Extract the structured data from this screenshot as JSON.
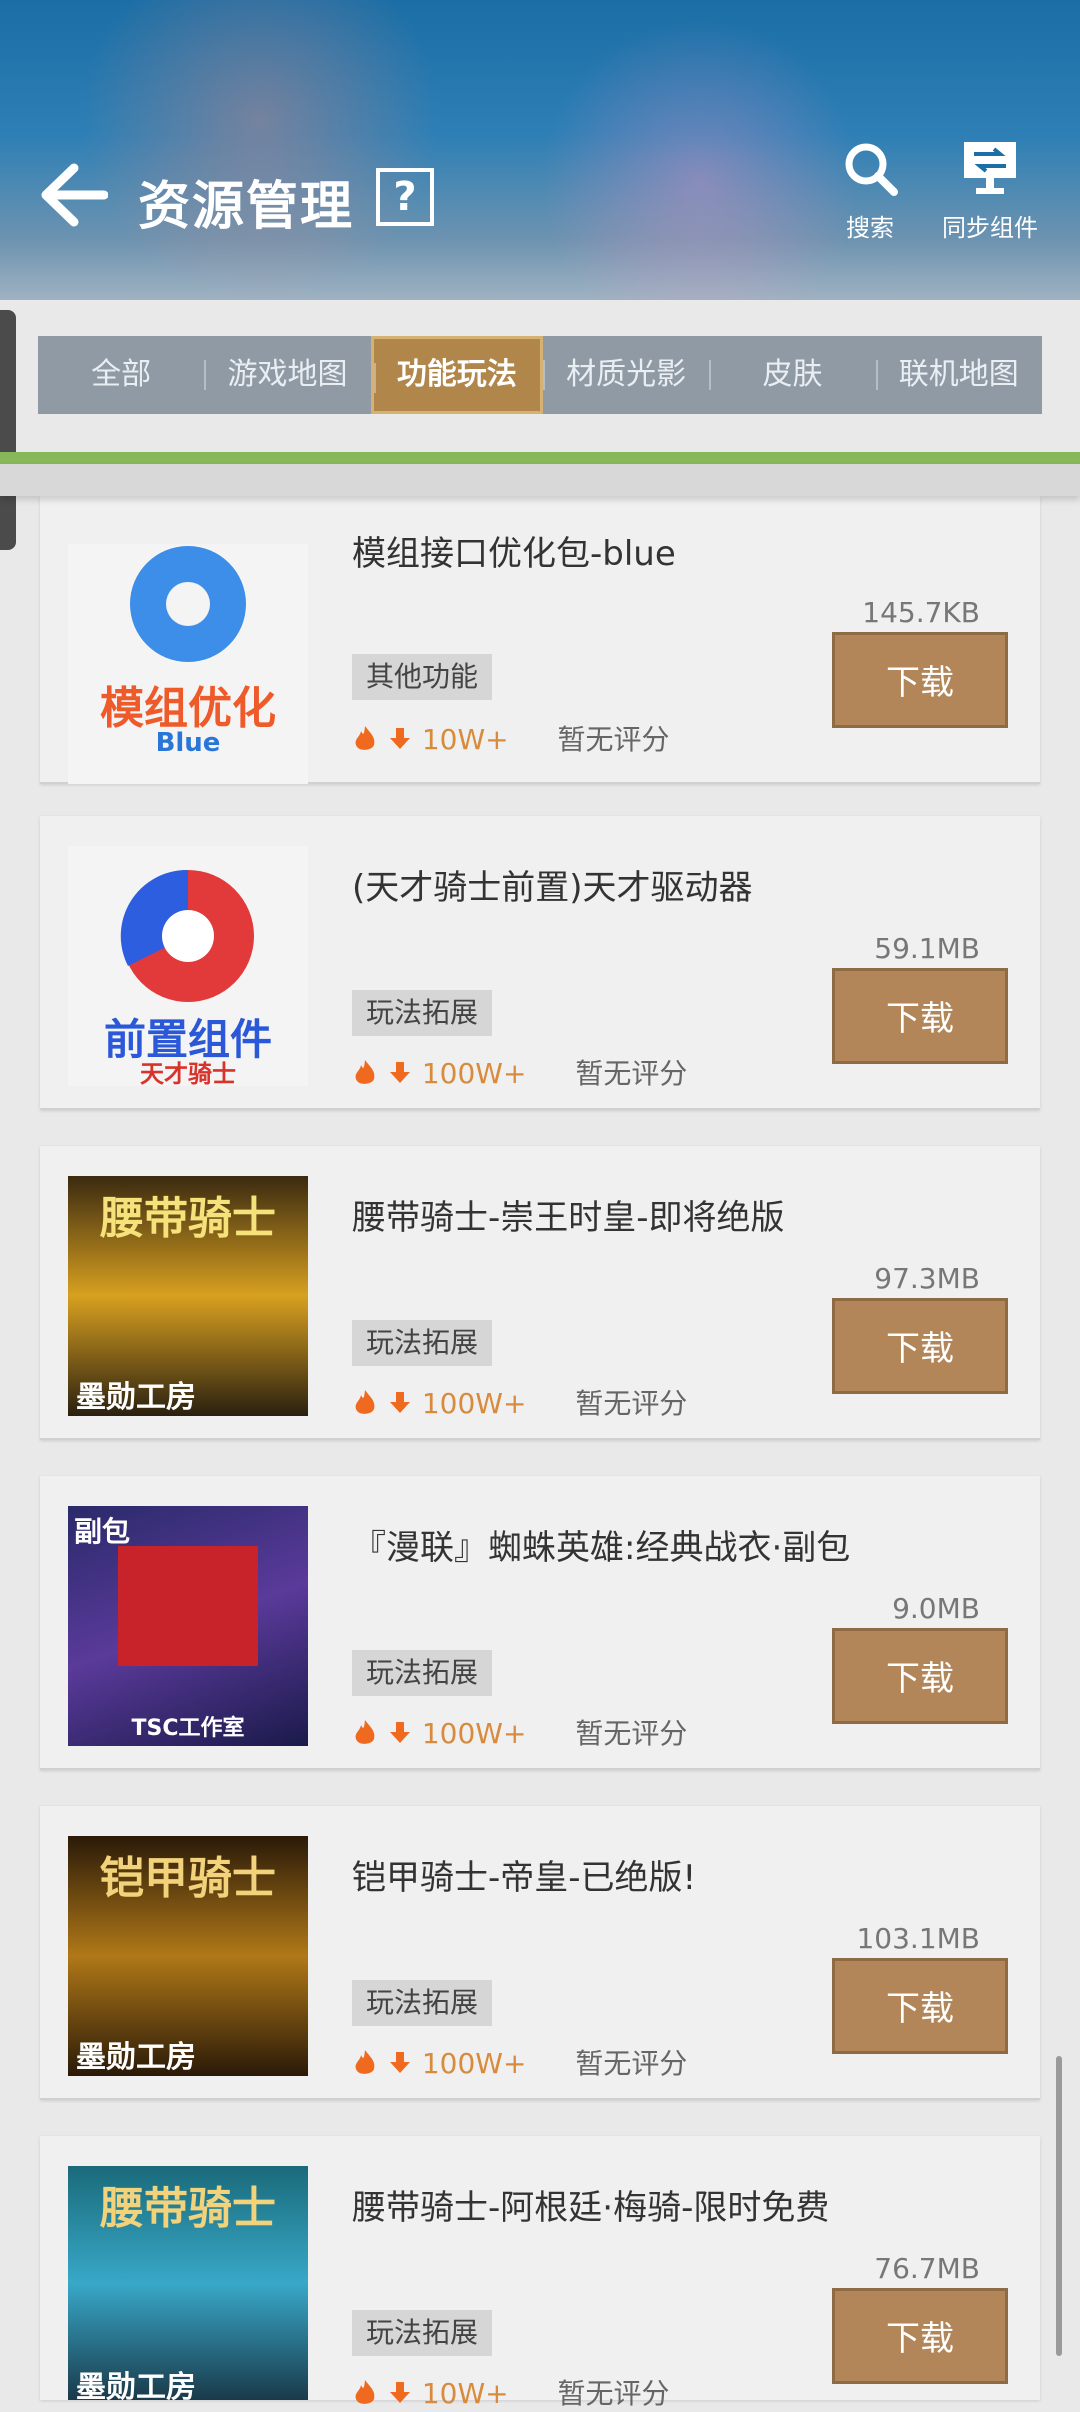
{
  "header": {
    "title": "资源管理",
    "help_symbol": "?",
    "search_label": "搜索",
    "sync_label": "同步组件"
  },
  "tabs": [
    {
      "label": "全部",
      "active": false
    },
    {
      "label": "游戏地图",
      "active": false
    },
    {
      "label": "功能玩法",
      "active": true
    },
    {
      "label": "材质光影",
      "active": false
    },
    {
      "label": "皮肤",
      "active": false
    },
    {
      "label": "联机地图",
      "active": false
    }
  ],
  "items": [
    {
      "title": "模组接口优化包-blue",
      "size": "145.7KB",
      "tag": "其他功能",
      "downloads": "10W+",
      "rating": "暂无评分",
      "download_label": "下载",
      "thumb_text": "模组优化",
      "thumb_sub": "Blue"
    },
    {
      "title": "(天才骑士前置)天才驱动器",
      "size": "59.1MB",
      "tag": "玩法拓展",
      "downloads": "100W+",
      "rating": "暂无评分",
      "download_label": "下载",
      "thumb_text": "前置组件",
      "thumb_sub": "天才骑士"
    },
    {
      "title": "腰带骑士-崇王时皇-即将绝版",
      "size": "97.3MB",
      "tag": "玩法拓展",
      "downloads": "100W+",
      "rating": "暂无评分",
      "download_label": "下载",
      "thumb_text": "腰带骑士",
      "thumb_sub": "墨勋工房"
    },
    {
      "title": "『漫联』蜘蛛英雄:经典战衣·副包",
      "size": "9.0MB",
      "tag": "玩法拓展",
      "downloads": "100W+",
      "rating": "暂无评分",
      "download_label": "下载",
      "thumb_text": "副包",
      "thumb_sub": "TSC工作室"
    },
    {
      "title": "铠甲骑士-帝皇-已绝版!",
      "size": "103.1MB",
      "tag": "玩法拓展",
      "downloads": "100W+",
      "rating": "暂无评分",
      "download_label": "下载",
      "thumb_text": "铠甲骑士",
      "thumb_sub": "墨勋工房"
    },
    {
      "title": "腰带骑士-阿根廷·梅骑-限时免费",
      "size": "76.7MB",
      "tag": "玩法拓展",
      "downloads": "10W+",
      "rating": "暂无评分",
      "download_label": "下载",
      "thumb_text": "腰带骑士",
      "thumb_sub": "墨勋工房"
    }
  ],
  "colors": {
    "accent": "#b0864a",
    "download_button": "#b28659",
    "tab_bar": "#465a6e",
    "green_line": "#86b85a"
  }
}
